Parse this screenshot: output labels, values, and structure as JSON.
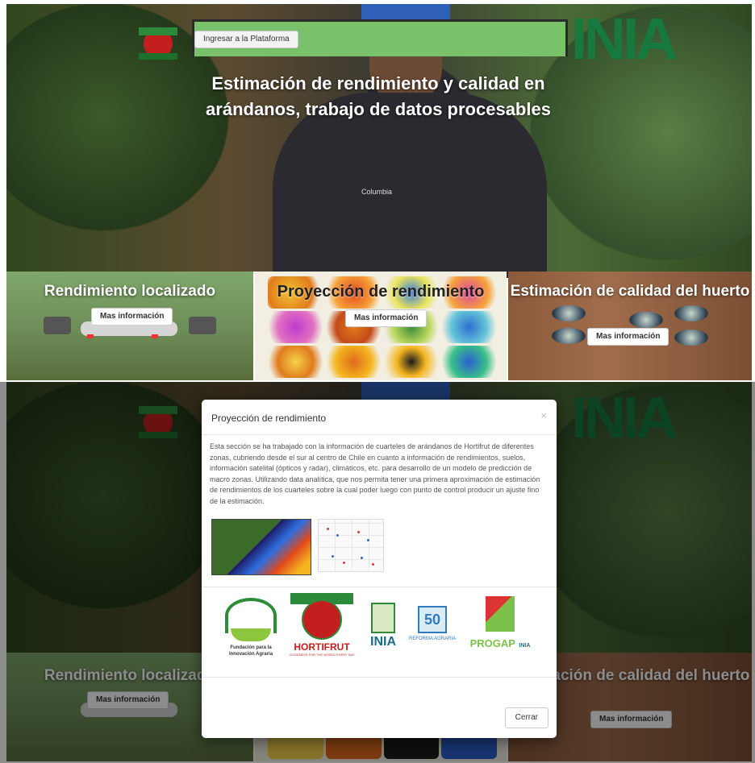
{
  "header": {
    "login_button": "Ingresar a la Plataforma",
    "inia_wordmark": "INIA"
  },
  "hero": {
    "title": "Estimación de rendimiento y calidad en arándanos, trabajo de datos procesables",
    "shirt_brand": "Columbia"
  },
  "cards": [
    {
      "title": "Rendimiento localizado",
      "button": "Mas información"
    },
    {
      "title": "Proyección de rendimiento",
      "button": "Mas información"
    },
    {
      "title": "Estimación de calidad del huerto",
      "button": "Mas información"
    }
  ],
  "modal": {
    "title": "Proyección de rendimiento",
    "close_symbol": "×",
    "body": "Esta sección se ha trabajado con la información de cuarteles de arándanos de Hortifrut de diferentes zonas, cubriendo desde el sur al centro de Chile en cuanto a información de rendimientos, suelos, información satelital (ópticos y radar), climáticos, etc. para desarrollo de un modelo de predicción de macro zonas. Utilizando data analítica, que nos permita tener una primera aproximación de estimación de rendimientos de los cuarteles sobre la cual poder luego con punto de control producir un ajuste fino de la estimación.",
    "close_button": "Cerrar",
    "sponsors": [
      {
        "name": "FIA",
        "caption": "Fundación para la Innovación Agraria"
      },
      {
        "name": "HORTIFRUT",
        "caption": "GOODNESS FOR THE WORLD EVERY DAY"
      },
      {
        "name": "INIA",
        "caption": ""
      },
      {
        "name": "50",
        "caption": "REFORMA AGRARIA"
      },
      {
        "name": "PROGAP",
        "caption": "INIA"
      }
    ]
  },
  "colors": {
    "nav_green": "#79c16a",
    "inia_green": "#167a3f",
    "hortifrut_red": "#c41f1f"
  }
}
